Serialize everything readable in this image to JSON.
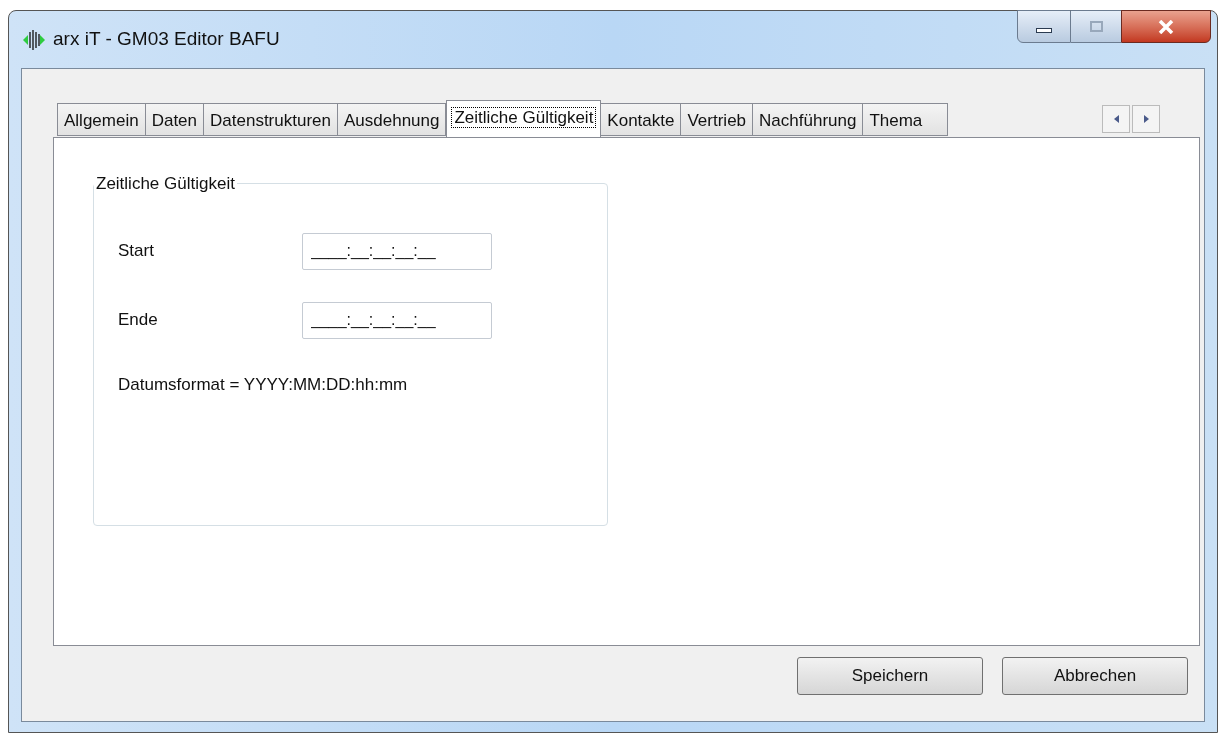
{
  "window": {
    "title": "arx iT - GM03 Editor BAFU"
  },
  "tabs": [
    {
      "label": "Allgemein",
      "selected": false
    },
    {
      "label": "Daten",
      "selected": false
    },
    {
      "label": "Datenstrukturen",
      "selected": false
    },
    {
      "label": "Ausdehnung",
      "selected": false
    },
    {
      "label": "Zeitliche Gültigkeit",
      "selected": true
    },
    {
      "label": "Kontakte",
      "selected": false
    },
    {
      "label": "Vertrieb",
      "selected": false
    },
    {
      "label": "Nachführung",
      "selected": false
    },
    {
      "label": "Thema",
      "selected": false
    }
  ],
  "group": {
    "title": "Zeitliche Gültigkeit",
    "fields": [
      {
        "label": "Start",
        "value": "____:__:__:__:__"
      },
      {
        "label": "Ende",
        "value": "____:__:__:__:__"
      }
    ],
    "note": "Datumsformat = YYYY:MM:DD:hh:mm"
  },
  "buttons": [
    "Speichern",
    "Abbrechen"
  ]
}
